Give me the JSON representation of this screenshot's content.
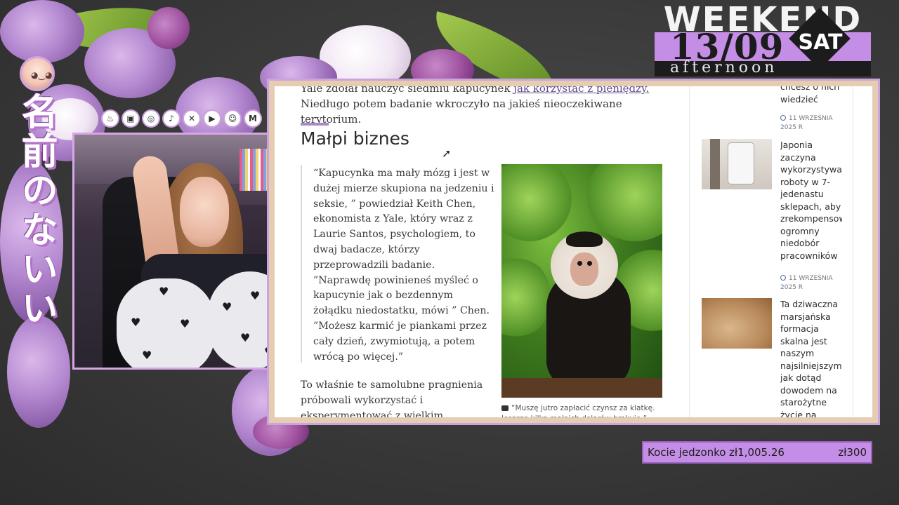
{
  "overlay": {
    "weekend": {
      "word": "WEEKEND",
      "date": "13/09",
      "day": "SAT",
      "period": "afternoon"
    },
    "vertical_name": "名前のないい",
    "socials": [
      "kofi-icon",
      "twitch-icon",
      "instagram-icon",
      "tiktok-icon",
      "x-icon",
      "youtube-icon",
      "discord-icon",
      "mail-icon"
    ],
    "goal": {
      "name": "Kocie jedzonko",
      "current": "zł1,005.26",
      "target": "zł300"
    },
    "colors": {
      "accent": "#c58ee6",
      "frame": "#e6ccb0"
    }
  },
  "article": {
    "intro_start": "Yale zdołał nauczyć siedmiu kapucynek ",
    "intro_link": "jak korzystać z pieniędzy.",
    "intro_end": "Niedługo potem badanie wkroczyło na jakieś nieoczekiwane terytorium.",
    "heading": "Małpi biznes",
    "quote": "“Kapucynka ma mały mózg i jest w\ndużej mierze skupiona na jedzeniu i\nseksie, ” powiedział Keith Chen,\nekonomista z Yale, który wraz z\nLaurie Santos, psychologiem, to\ndwaj badacze, którzy\nprzeprowadzili badanie.\n”Naprawdę powinieneś myśleć o\nkapucynie jak o bezdennym\nżołądku niedostatku, mówi ” Chen.\n”Możesz karmić je piankami przez\ncały dzień, zwymiotują, a potem\nwrócą po więcej.”",
    "paragraph": "To właśnie te samolubne pragnienia\npróbowali wykorzystać i\neksperymentować z wielkim",
    "caption": "“Muszę jutro zapłacić czynsz za klatkę.\nJeszcze kilka małpich dolarów brakuje.”"
  },
  "sidebar": {
    "items": [
      {
        "title": "chcesz o nich\nwiedzieć",
        "date": "11 WRZEŚNIA\n2025 R"
      },
      {
        "title": "Japonia\nzaczyna\nwykorzystywać\nroboty w 7-\njedenastu\nsklepach, aby\nzrekompensować\nogromny\nniedobór\npracowników",
        "date": "11 WRZEŚNIA\n2025 R"
      },
      {
        "title": "Ta dziwaczna\nmarsjańska\nformacja\nskalna jest\nnaszym\nnajsilniejszym\njak dotąd\ndowodem na\nstarożytne\nżycie na",
        "date": ""
      }
    ]
  }
}
